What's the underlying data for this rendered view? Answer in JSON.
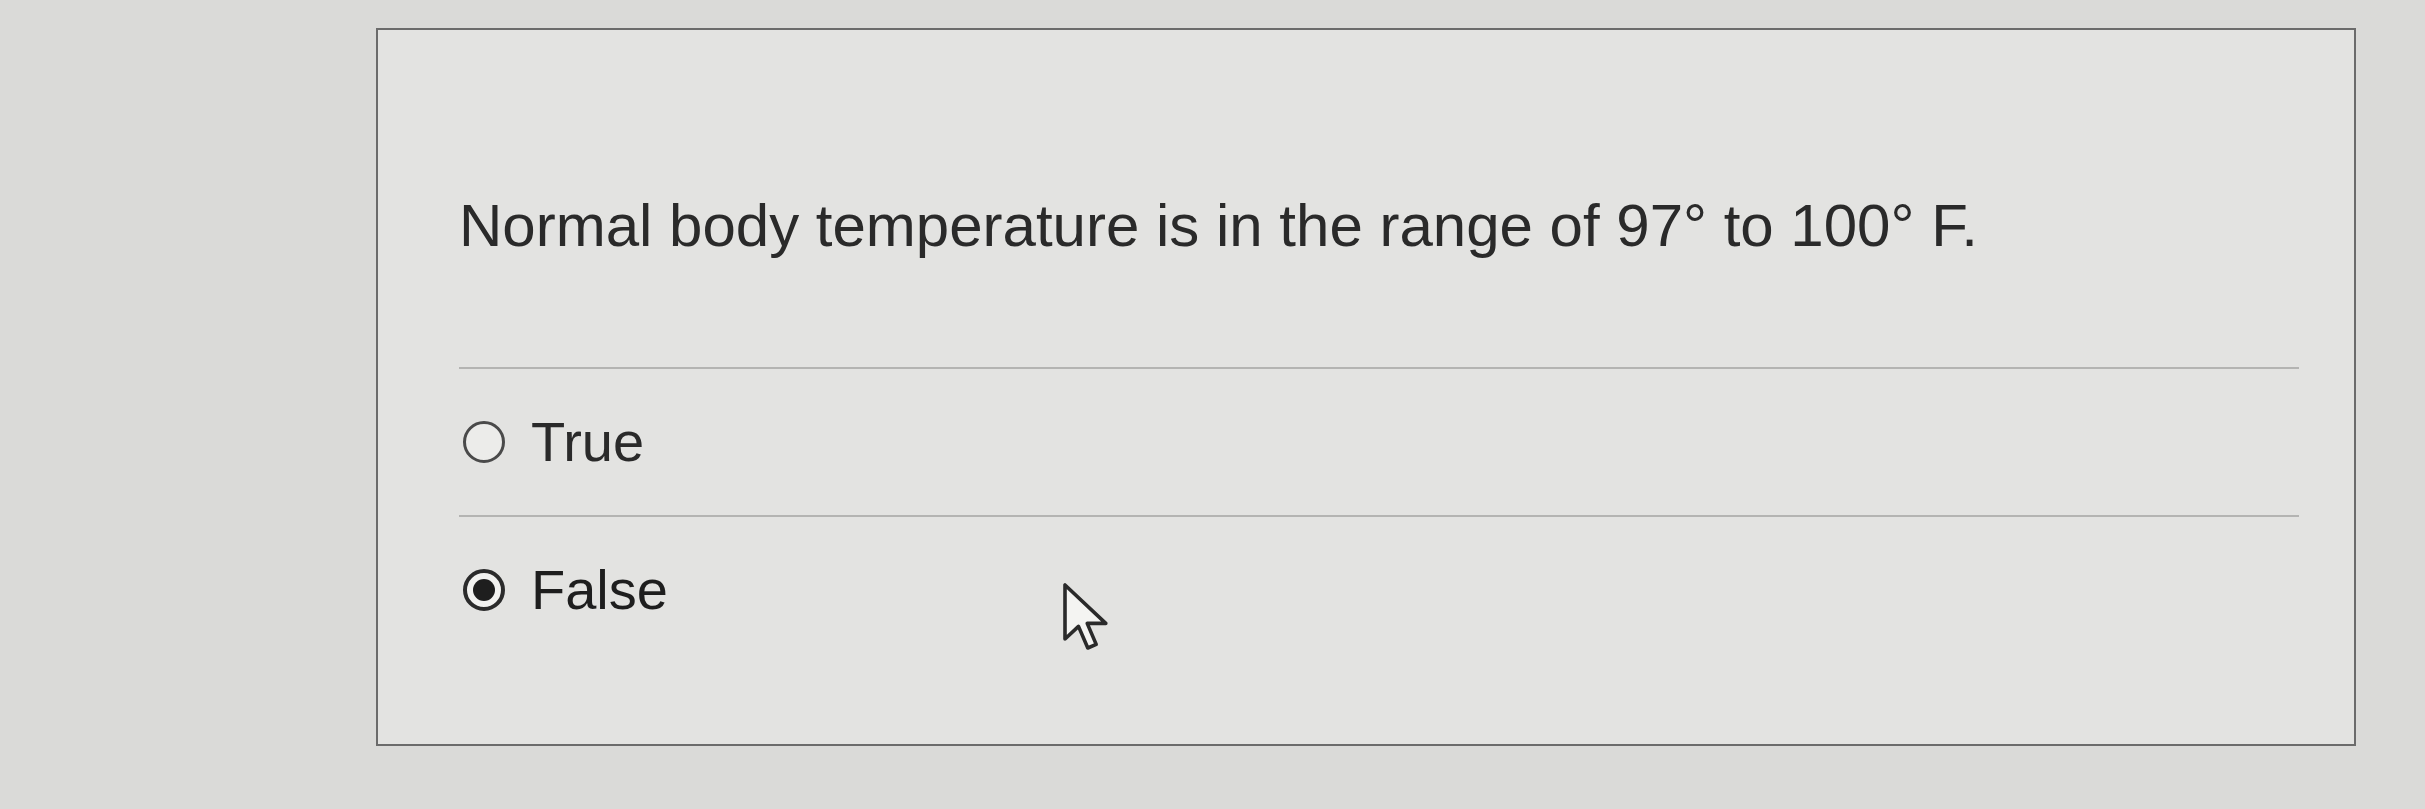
{
  "question": {
    "text": "Normal body temperature is in the range of 97° to 100° F."
  },
  "options": [
    {
      "label": "True",
      "selected": false
    },
    {
      "label": "False",
      "selected": true
    }
  ]
}
